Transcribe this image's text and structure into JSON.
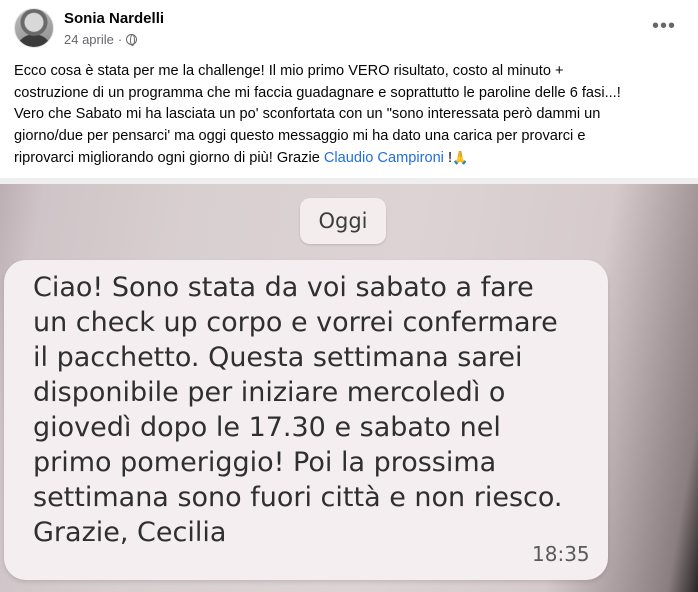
{
  "post": {
    "author": "Sonia Nardelli",
    "date": "24 aprile",
    "separator": "·",
    "more_icon": "more-horizontal-icon",
    "text_lines": [
      "Ecco cosa è stata per me la challenge! Il mio primo VERO risultato, costo al minuto +",
      "costruzione di un programma che mi faccia guadagnare e soprattutto le paroline delle 6 fasi...!",
      "Vero che Sabato mi ha lasciata un po' sconfortata con un \"sono interessata però dammi un",
      "giorno/due per pensarci' ma oggi questo messaggio mi ha dato una carica per provarci e",
      "riprovarci migliorando ogni giorno di più! Grazie"
    ],
    "mention": "Claudio Campironi",
    "text_end": " !",
    "emoji": "🙏"
  },
  "photo": {
    "date_chip": "Oggi",
    "message_lines": [
      "Ciao! Sono stata da voi sabato a fare",
      "un check up corpo e vorrei confermare",
      "il pacchetto. Questa settimana sarei",
      "disponibile per iniziare mercoledì o",
      "giovedì dopo le 17.30 e sabato nel",
      "primo pomeriggio! Poi la prossima",
      "settimana sono fuori città e non riesco.",
      "Grazie, Cecilia"
    ],
    "time": "18:35"
  }
}
